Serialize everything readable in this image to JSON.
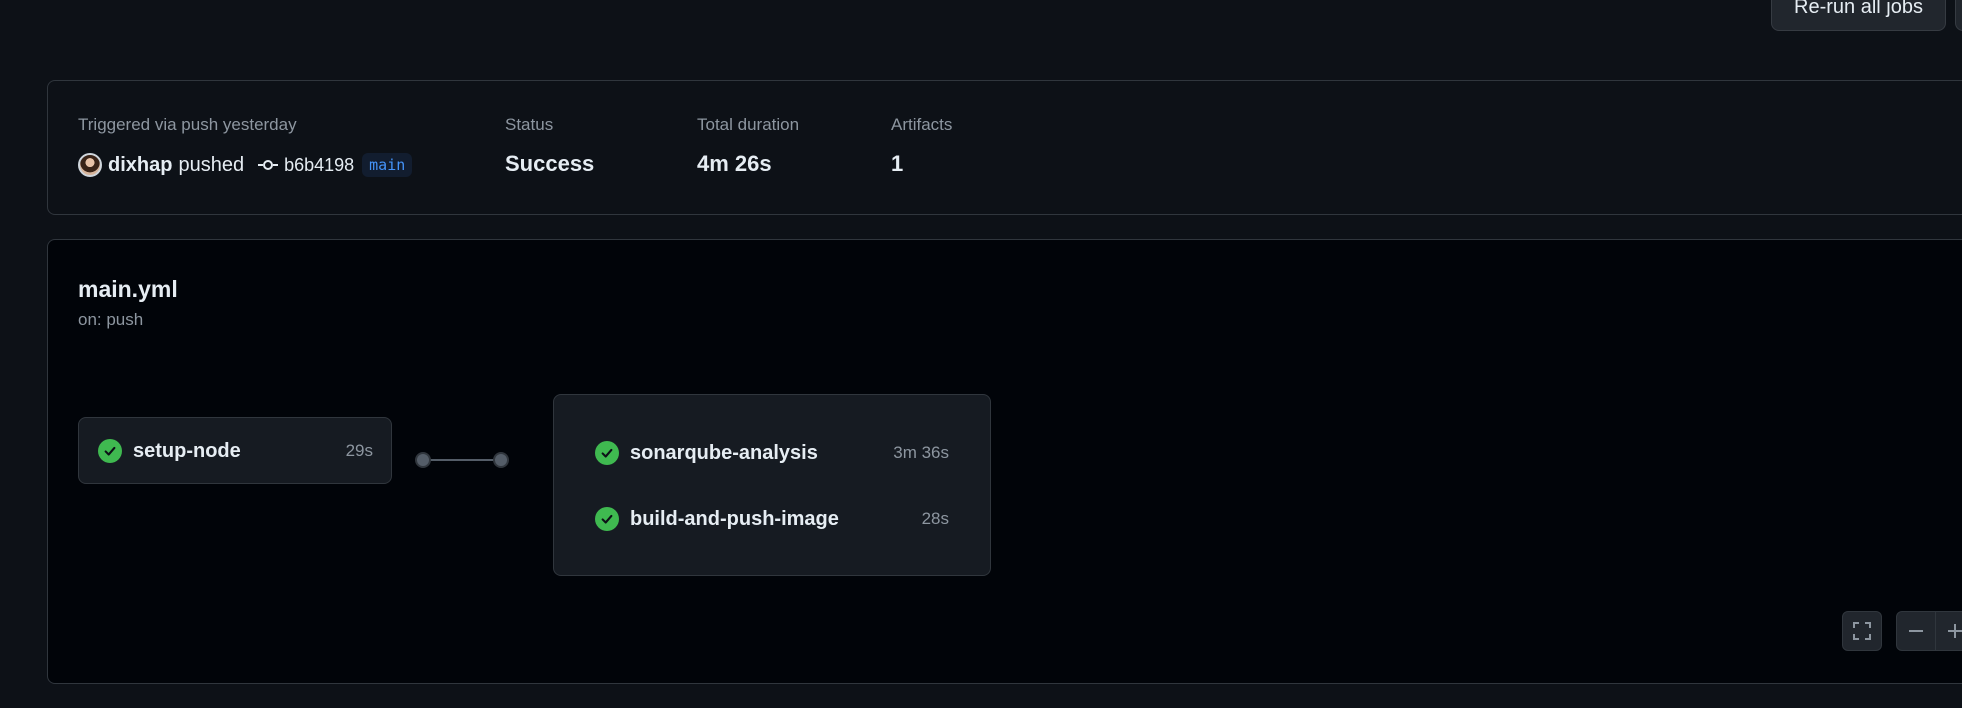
{
  "header": {
    "rerun_label": "Re-run all jobs"
  },
  "summary": {
    "trigger_label": "Triggered via push yesterday",
    "actor": "dixhap",
    "action": "pushed",
    "commit_sha": "b6b4198",
    "branch": "main",
    "status_label": "Status",
    "status_value": "Success",
    "duration_label": "Total duration",
    "duration_value": "4m 26s",
    "artifacts_label": "Artifacts",
    "artifacts_value": "1"
  },
  "workflow": {
    "file": "main.yml",
    "trigger": "on: push",
    "jobs": [
      {
        "name": "setup-node",
        "duration": "29s",
        "status": "success"
      },
      {
        "name": "sonarqube-analysis",
        "duration": "3m 36s",
        "status": "success"
      },
      {
        "name": "build-and-push-image",
        "duration": "28s",
        "status": "success"
      }
    ]
  },
  "zoom_controls": [
    "fullscreen-icon",
    "zoom-out-icon",
    "zoom-in-icon"
  ],
  "colors": {
    "success": "#3fb950",
    "link": "#4493f8",
    "background": "#0d1117",
    "canvas": "#010409"
  }
}
